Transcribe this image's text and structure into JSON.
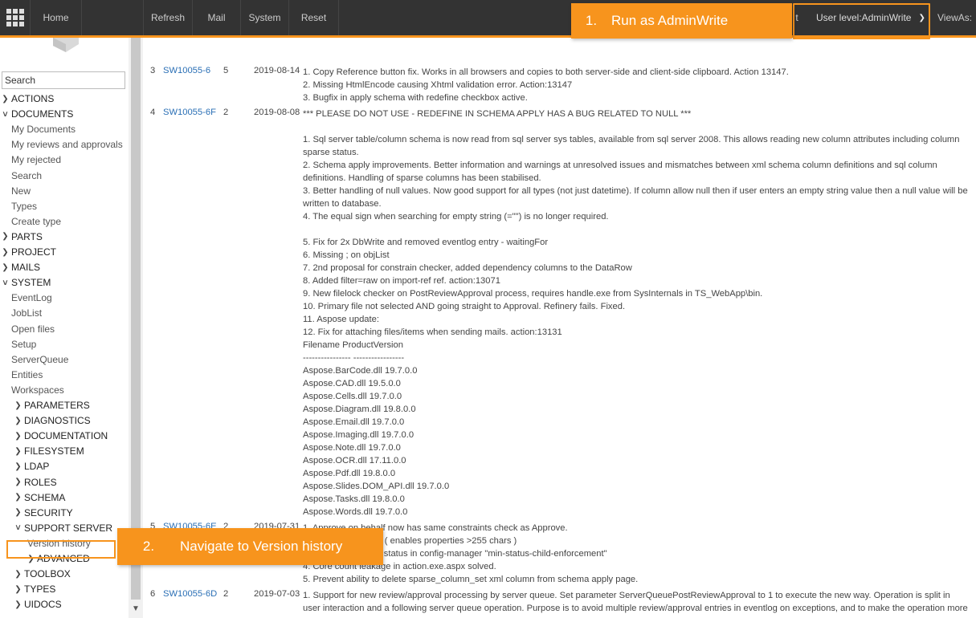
{
  "topbar": {
    "home": "Home",
    "refresh": "Refresh",
    "mail": "Mail",
    "system": "System",
    "reset": "Reset",
    "partial_item": "t",
    "user_level": "User level:AdminWrite",
    "view_as": "ViewAs:"
  },
  "sidebar": {
    "search_placeholder": "Search",
    "items": [
      {
        "label": "ACTIONS",
        "indent": 0,
        "icon": "chevron-right-icon"
      },
      {
        "label": "DOCUMENTS",
        "indent": 0,
        "icon": "chevron-down-icon"
      },
      {
        "label": "My Documents",
        "indent": 1
      },
      {
        "label": "My reviews and approvals",
        "indent": 1
      },
      {
        "label": "My rejected",
        "indent": 1
      },
      {
        "label": "Search",
        "indent": 1
      },
      {
        "label": "New",
        "indent": 1
      },
      {
        "label": "Types",
        "indent": 1
      },
      {
        "label": "Create type",
        "indent": 1
      },
      {
        "label": "PARTS",
        "indent": 0,
        "icon": "chevron-right-icon"
      },
      {
        "label": "PROJECT",
        "indent": 0,
        "icon": "chevron-right-icon"
      },
      {
        "label": "MAILS",
        "indent": 0,
        "icon": "chevron-right-icon"
      },
      {
        "label": "SYSTEM",
        "indent": 0,
        "icon": "chevron-down-icon"
      },
      {
        "label": "EventLog",
        "indent": 1
      },
      {
        "label": "JobList",
        "indent": 1
      },
      {
        "label": "Open files",
        "indent": 1
      },
      {
        "label": "Setup",
        "indent": 1
      },
      {
        "label": "ServerQueue",
        "indent": 1
      },
      {
        "label": "Entities",
        "indent": 1
      },
      {
        "label": "Workspaces",
        "indent": 1
      },
      {
        "label": "PARAMETERS",
        "indent": 2,
        "icon": "chevron-right-icon"
      },
      {
        "label": "DIAGNOSTICS",
        "indent": 2,
        "icon": "chevron-right-icon"
      },
      {
        "label": "DOCUMENTATION",
        "indent": 2,
        "icon": "chevron-right-icon"
      },
      {
        "label": "FILESYSTEM",
        "indent": 2,
        "icon": "chevron-right-icon"
      },
      {
        "label": "LDAP",
        "indent": 2,
        "icon": "chevron-right-icon"
      },
      {
        "label": "ROLES",
        "indent": 2,
        "icon": "chevron-right-icon"
      },
      {
        "label": "SCHEMA",
        "indent": 2,
        "icon": "chevron-right-icon"
      },
      {
        "label": "SECURITY",
        "indent": 2,
        "icon": "chevron-right-icon"
      },
      {
        "label": "SUPPORT SERVER",
        "indent": 2,
        "icon": "chevron-down-icon"
      },
      {
        "label": "Version history",
        "indent": 3,
        "selected": true
      },
      {
        "label": "ADVANCED",
        "indent": 3,
        "icon": "chevron-right-icon"
      },
      {
        "label": "TOOLBOX",
        "indent": 2,
        "icon": "chevron-right-icon"
      },
      {
        "label": "TYPES",
        "indent": 2,
        "icon": "chevron-right-icon"
      },
      {
        "label": "UIDOCS",
        "indent": 2,
        "icon": "chevron-right-icon"
      }
    ]
  },
  "versions": [
    {
      "num": "3",
      "id": "SW10055-6",
      "level": "5",
      "date": "2019-08-14",
      "lines": [
        "1. Copy Reference button fix. Works in all browsers and copies to both server-side and client-side clipboard. Action 13147.",
        "2. Missing HtmlEncode causing Xhtml validation error. Action:13147",
        "3. Bugfix in apply schema with redefine checkbox active."
      ]
    },
    {
      "num": "4",
      "id": "SW10055-6F",
      "level": "2",
      "date": "2019-08-08",
      "lines": [
        "*** PLEASE DO NOT USE - REDEFINE IN SCHEMA APPLY HAS A BUG RELATED TO NULL ***",
        "",
        "1. Sql server table/column schema is now read from sql server sys tables, available from sql server 2008. This allows reading new column attributes including column sparse status.",
        "2. Schema apply improvements. Better information and warnings at unresolved issues and mismatches between xml schema column definitions and sql column definitions. Handling of sparse columns has been stabilised.",
        "3. Better handling of null values. Now good support for all types (not just datetime). If column allow null then if user enters an empty string value then a null value will be written to database.",
        "4. The equal sign when searching for empty string (=\"\") is no longer required.",
        "",
        "5. Fix for 2x DbWrite and removed eventlog entry - waitingFor",
        "6. Missing ; on objList",
        "7. 2nd proposal for constrain checker, added dependency columns to the DataRow",
        "8. Added filter=raw on import-ref ref. action:13071",
        "9. New filelock checker on PostReviewApproval process, requires handle.exe from SysInternals in TS_WebApp\\bin.",
        "10. Primary file not selected AND going straight to Approval. Refinery fails. Fixed.",
        "11. Aspose update:",
        "12. Fix for attaching files/items when sending mails. action:13131",
        "Filename ProductVersion",
        "---------------- -----------------",
        "Aspose.BarCode.dll 19.7.0.0",
        "Aspose.CAD.dll 19.5.0.0",
        "Aspose.Cells.dll 19.7.0.0",
        "Aspose.Diagram.dll 19.8.0.0",
        "Aspose.Email.dll 19.7.0.0",
        "Aspose.Imaging.dll 19.7.0.0",
        "Aspose.Note.dll 19.7.0.0",
        "Aspose.OCR.dll 17.11.0.0",
        "Aspose.Pdf.dll 19.8.0.0",
        "Aspose.Slides.DOM_API.dll 19.7.0.0",
        "Aspose.Tasks.dll 19.8.0.0",
        "Aspose.Words.dll 19.7.0.0"
      ]
    },
    {
      "num": "5",
      "id": "SW10055-6E",
      "level": "2",
      "date": "2019-07-31",
      "lines": [
        "1. Approve on behalf now has same constraints check as Approve.",
        "2. variables in Word ( enables properties >255 chars )",
        "3. or enforcing child status in config-manager \"min-status-child-enforcement\"",
        "4. Core count leakage in action.exe.aspx solved.",
        "5. Prevent ability to delete sparse_column_set xml column from schema apply page."
      ]
    },
    {
      "num": "6",
      "id": "SW10055-6D",
      "level": "2",
      "date": "2019-07-03",
      "lines": [
        "1. Support for new review/approval processing by server queue. Set parameter ServerQueuePostReviewApproval to 1 to execute the new way. Operation is split in user interaction and a following server queue operation. Purpose is to avoid multiple review/approval entries in eventlog on exceptions, and to make the operation more"
      ]
    }
  ],
  "callouts": {
    "step1_num": "1.",
    "step1_text": "Run as AdminWrite",
    "step2_num": "2.",
    "step2_text": "Navigate to Version history"
  },
  "colors": {
    "accent": "#f7941d",
    "topbar": "#333333",
    "link": "#2a6fb5"
  }
}
